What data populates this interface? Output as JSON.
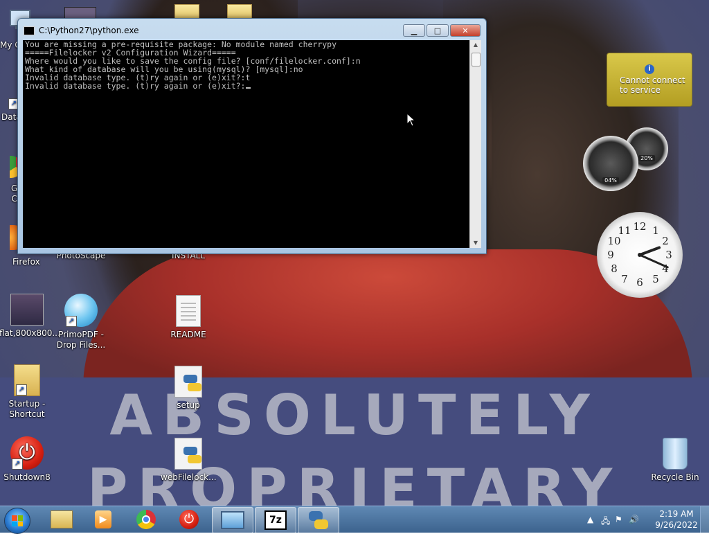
{
  "desktop": {
    "icons": [
      {
        "label": "My C",
        "name": "computer"
      },
      {
        "label": "Data",
        "name": "data-shortcut"
      },
      {
        "label": "G\nC",
        "name": "chrome-partial"
      },
      {
        "label": "Firefox",
        "name": "firefox"
      },
      {
        "label": "PhotoScape",
        "name": "photoscape"
      },
      {
        "label": "INSTALL",
        "name": "install"
      },
      {
        "label": "flat,800x800...",
        "name": "flat-image"
      },
      {
        "label": "PrimoPDF - Drop Files...",
        "name": "primopdf"
      },
      {
        "label": "README",
        "name": "readme"
      },
      {
        "label": "Startup - Shortcut",
        "name": "startup-shortcut"
      },
      {
        "label": "setup",
        "name": "setup"
      },
      {
        "label": "Shutdown8",
        "name": "shutdown8"
      },
      {
        "label": "webFilelock...",
        "name": "webfilelocker"
      },
      {
        "label": "Recycle Bin",
        "name": "recycle-bin"
      }
    ],
    "wallpaper_text": [
      "ABSOLUTELY",
      "PROPRIETARY"
    ]
  },
  "console_window": {
    "title": "C:\\Python27\\python.exe",
    "lines": [
      "You are missing a pre-requisite package: No module named cherrypy",
      "=====Filelocker v2 Configuration Wizard=====",
      "Where would you like to save the config file? [conf/filelocker.conf]:n",
      "What kind of database will you be using(mysql)? [mysql]:no",
      "Invalid database type. (t)ry again or (e)xit?:t",
      "Invalid database type. (t)ry again or (e)xit?:"
    ]
  },
  "gadgets": {
    "weather_message": "Cannot connect to service",
    "cpu_percent": "04%",
    "memory_percent": "20%",
    "clock": {
      "hour": 2,
      "minute": 19
    }
  },
  "taskbar": {
    "apps": [
      "explorer",
      "media-player",
      "chrome",
      "shutdown",
      "screen-viewer",
      "7zip",
      "python-console"
    ],
    "time": "2:19 AM",
    "date": "9/26/2022"
  },
  "colors": {
    "taskbar": "#3c638e",
    "console_bg": "#000000",
    "console_fg": "#c0c0c0",
    "close_button": "#c4402b"
  }
}
